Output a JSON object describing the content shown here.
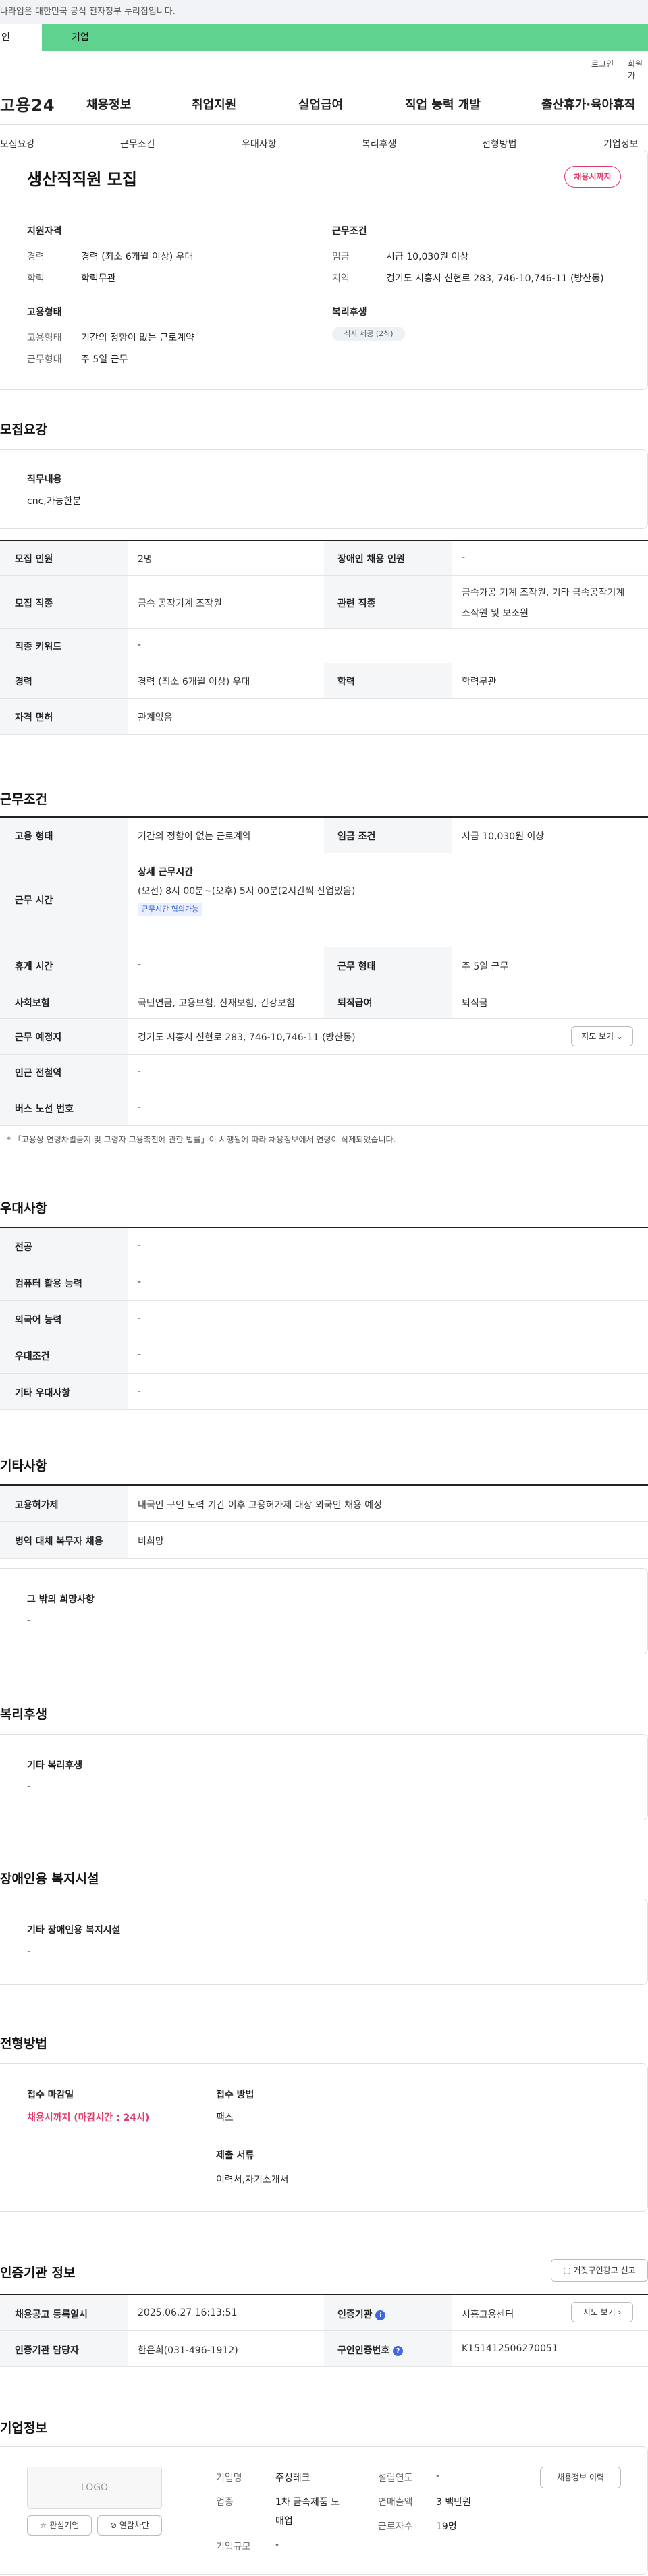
{
  "gov_bar": {
    "text": "나라입은 대한민국 공식 전자정부 누리집입니다."
  },
  "top_tabs": {
    "personal": "인",
    "company": "기업"
  },
  "util": {
    "login": "로그인",
    "join": "회원가"
  },
  "logo": "고용24",
  "gnb": [
    "채용정보",
    "취업지원",
    "실업급여",
    "직업 능력 개발",
    "출산휴가·육아휴직"
  ],
  "snb": [
    "모집요강",
    "근무조건",
    "우대사항",
    "복리후생",
    "전형방법",
    "기업정보"
  ],
  "summary": {
    "title": "생산직직원 모집",
    "badge": "채용시까지",
    "qual_title": "지원자격",
    "career_k": "경력",
    "career_v": "경력 (최소 6개월 이상) 우대",
    "edu_k": "학력",
    "edu_v": "학력무관",
    "cond_title": "근무조건",
    "wage_k": "임금",
    "wage_v": "시급 10,030원 이상",
    "region_k": "지역",
    "region_v": "경기도 시흥시 신현로 283, 746-10,746-11 (방산동)",
    "emp_title": "고용형태",
    "type_k": "고용형태",
    "type_v": "기간의 정함이 없는 근로계약",
    "days_k": "근무형태",
    "days_v": "주 5일 근무",
    "welfare_title": "복리후생",
    "welfare_chip": "식사 제공 (2식)"
  },
  "recruit": {
    "section": "모집요강",
    "duty_title": "직무내용",
    "duty_text": "cnc,가능한분",
    "rows": {
      "r1": {
        "k1": "모집 인원",
        "v1": "2명",
        "k2": "장애인 채용 인원",
        "v2": "-"
      },
      "r2": {
        "k1": "모집 직종",
        "v1": "금속 공작기계 조작원",
        "k2": "관련 직종",
        "v2a": "금속가공 기계 조작원, 기타 금속공작기계",
        "v2b": "조작원 및 보조원"
      },
      "r3": {
        "k1": "직종 키워드",
        "v1": "-"
      },
      "r4": {
        "k1": "경력",
        "v1": "경력 (최소 6개월 이상) 우대",
        "k2": "학력",
        "v2": "학력무관"
      },
      "r5": {
        "k1": "자격 면허",
        "v1": "관계없음"
      }
    }
  },
  "work": {
    "section": "근무조건",
    "r1": {
      "k1": "고용 형태",
      "v1": "기간의 정함이 없는 근로계약",
      "k2": "임금 조건",
      "v2": "시급 10,030원 이상"
    },
    "r2": {
      "k1": "근무 시간",
      "detail_title": "상세 근무시간",
      "detail_text": "(오전) 8시 00분~(오후) 5시 00분(2시간씩 잔업있음)",
      "chip": "근무시간 협의가능"
    },
    "r3": {
      "k1": "휴게 시간",
      "v1": "-",
      "k2": "근무 형태",
      "v2": "주 5일 근무"
    },
    "r4": {
      "k1": "사회보험",
      "v1": "국민연금, 고용보험, 산재보험, 건강보험",
      "k2": "퇴직급여",
      "v2": "퇴직금"
    },
    "r5": {
      "k1": "근무 예정지",
      "v1": "경기도 시흥시 신현로 283, 746-10,746-11 (방산동)",
      "btn": "지도 보기"
    },
    "r6": {
      "k1": "인근 전철역",
      "v1": "-"
    },
    "r7": {
      "k1": "버스 노선 번호",
      "v1": "-"
    },
    "note": "* 「고용상 연령차별금지 및 고령자 고용촉진에 관한 법률」이 시행됨에 따라 채용정보에서 연령이 삭제되었습니다."
  },
  "pref": {
    "section": "우대사항",
    "rows": [
      {
        "k": "전공",
        "v": "-"
      },
      {
        "k": "컴퓨터 활용 능력",
        "v": "-"
      },
      {
        "k": "외국어 능력",
        "v": "-"
      },
      {
        "k": "우대조건",
        "v": "-"
      },
      {
        "k": "기타 우대사항",
        "v": "-"
      }
    ]
  },
  "etc": {
    "section": "기타사항",
    "r1": {
      "k": "고용허가제",
      "v": "내국인 구인 노력 기간 이후 고용허가제 대상 외국인 채용 예정"
    },
    "r2": {
      "k": "병역 대체 복무자 채용",
      "v": "비희망"
    },
    "box_title": "그 밖의 희망사항",
    "box_text": "-"
  },
  "welfare": {
    "section": "복리후생",
    "box_title": "기타 복리후생",
    "box_text": "-"
  },
  "disability": {
    "section": "장애인용 복지시설",
    "box_title": "기타 장애인용 복지시설",
    "box_text": "-"
  },
  "screening": {
    "section": "전형방법",
    "deadline_title": "접수 마감일",
    "deadline_value": "채용시까지 (마감시간 : 24시)",
    "method_title": "접수 방법",
    "method_value": "팩스",
    "docs_title": "제출 서류",
    "docs_value": "이력서,자기소개서"
  },
  "agency": {
    "section": "인증기관 정보",
    "report_btn": "거짓구인광고 신고",
    "r1": {
      "k1": "채용공고 등록일시",
      "v1": "2025.06.27 16:13:51",
      "k2": "인증기관",
      "v2": "시흥고용센터",
      "btn": "지도 보기"
    },
    "r2": {
      "k1": "인증기관 담당자",
      "v1": "한은희(031-496-1912)",
      "k2": "구인인증번호",
      "v2": "K151412506270051"
    }
  },
  "company": {
    "section": "기업정보",
    "logo_text": "LOGO",
    "fav_btn": "관심기업",
    "block_btn": "열람차단",
    "name_k": "기업명",
    "name_v": "주성테크",
    "ind_k": "업종",
    "ind_v1": "1차 금속제품 도",
    "ind_v2": "매업",
    "size_k": "기업규모",
    "size_v": "-",
    "year_k": "설립연도",
    "year_v": "-",
    "sales_k": "연매출액",
    "sales_v": "3 백만원",
    "staff_k": "근로자수",
    "staff_v": "19명",
    "history_btn": "채용정보 이력"
  },
  "colors": {
    "accent": "#e23c6a",
    "tab_green": "#5ed28e",
    "header_gray": "#f5f6f8",
    "info_blue": "#4066e0"
  }
}
